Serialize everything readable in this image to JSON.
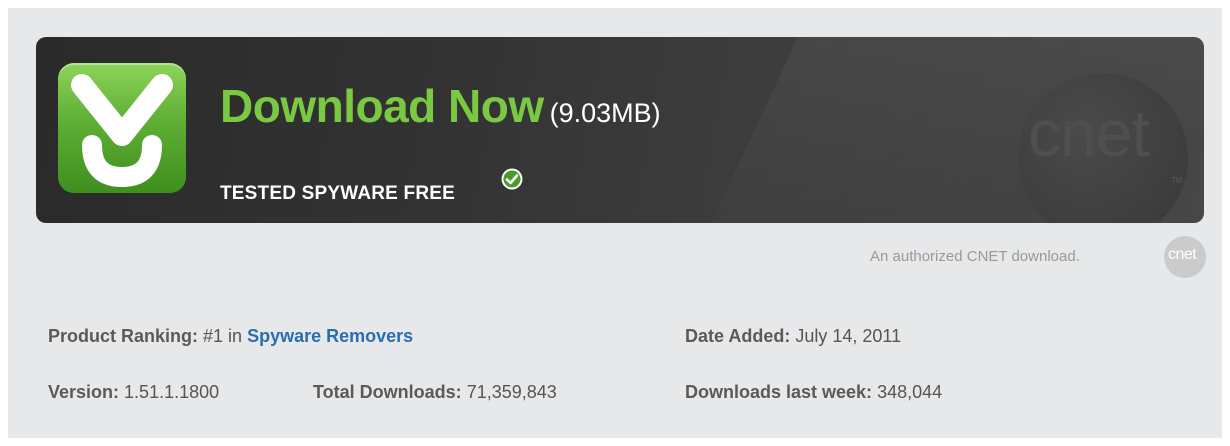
{
  "download": {
    "title": "Download Now",
    "size": "(9.03MB)",
    "tested": "TESTED SPYWARE FREE",
    "brand_logo_text": "cnet",
    "trademark": "TM",
    "authorized_text": "An authorized CNET download.",
    "mini_logo_text": "cnet"
  },
  "details": {
    "ranking_label": "Product Ranking:",
    "ranking_value": "#1 in",
    "ranking_link": "Spyware Removers",
    "date_added_label": "Date Added:",
    "date_added_value": "July 14, 2011",
    "version_label": "Version:",
    "version_value": "1.51.1.1800",
    "total_downloads_label": "Total Downloads:",
    "total_downloads_value": "71,359,843",
    "downloads_last_week_label": "Downloads last week:",
    "downloads_last_week_value": "348,044"
  },
  "icons": {
    "download": "download-arrow-icon",
    "check": "checkmark-circle-icon"
  },
  "colors": {
    "accent_green": "#7ac943",
    "link_blue": "#2a6db0",
    "banner_dark": "#333333"
  }
}
